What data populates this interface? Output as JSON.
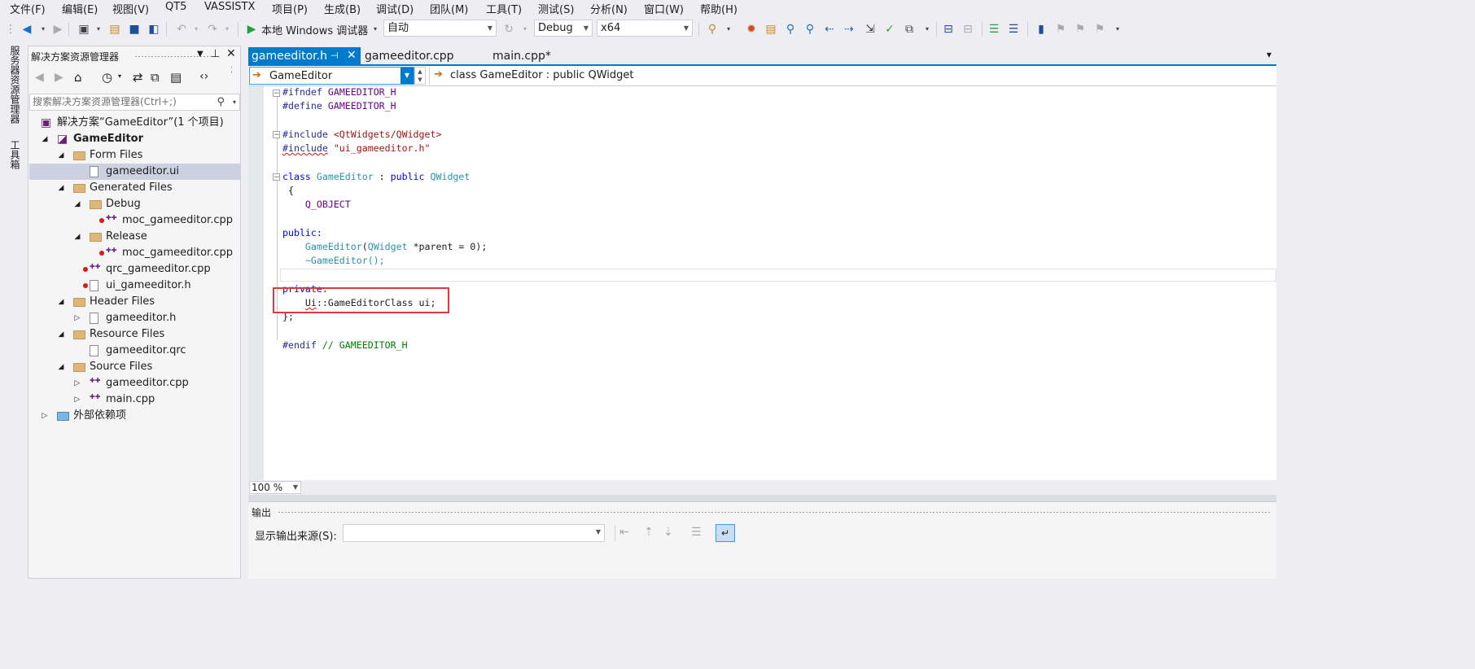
{
  "menu": [
    "文件(F)",
    "编辑(E)",
    "视图(V)",
    "QT5",
    "VASSISTX",
    "项目(P)",
    "生成(B)",
    "调试(D)",
    "团队(M)",
    "工具(T)",
    "测试(S)",
    "分析(N)",
    "窗口(W)",
    "帮助(H)"
  ],
  "toolbar": {
    "debugger_label": "本地 Windows 调试器",
    "config_auto": "自动",
    "configuration": "Debug",
    "platform": "x64"
  },
  "side_tabs": [
    "服务器资源管理器",
    "工具箱"
  ],
  "solution_explorer": {
    "title": "解决方案资源管理器",
    "search_placeholder": "搜索解决方案资源管理器(Ctrl+;)",
    "tree": [
      {
        "label": "解决方案“GameEditor”(1 个项目)",
        "indent": 0,
        "icon": "solution-icon",
        "expand": ""
      },
      {
        "label": "GameEditor",
        "indent": 1,
        "icon": "project-icon",
        "expand": "open",
        "bold": true
      },
      {
        "label": "Form Files",
        "indent": 2,
        "icon": "folder-icon",
        "expand": "open"
      },
      {
        "label": "gameeditor.ui",
        "indent": 3,
        "icon": "ui-file-icon",
        "expand": "",
        "selected": true
      },
      {
        "label": "Generated Files",
        "indent": 2,
        "icon": "folder-icon",
        "expand": "open"
      },
      {
        "label": "Debug",
        "indent": 3,
        "icon": "folder-icon",
        "expand": "open"
      },
      {
        "label": "moc_gameeditor.cpp",
        "indent": 4,
        "icon": "cpp-file-icon",
        "expand": "",
        "excluded": true
      },
      {
        "label": "Release",
        "indent": 3,
        "icon": "folder-icon",
        "expand": "open"
      },
      {
        "label": "moc_gameeditor.cpp",
        "indent": 4,
        "icon": "cpp-excluded-icon",
        "expand": "",
        "excluded": true
      },
      {
        "label": "qrc_gameeditor.cpp",
        "indent": 3,
        "icon": "cpp-file-icon",
        "expand": "",
        "excluded": true
      },
      {
        "label": "ui_gameeditor.h",
        "indent": 3,
        "icon": "header-file-icon",
        "expand": "",
        "excluded": true
      },
      {
        "label": "Header Files",
        "indent": 2,
        "icon": "folder-icon",
        "expand": "open"
      },
      {
        "label": "gameeditor.h",
        "indent": 3,
        "icon": "header-file-icon",
        "expand": "closed"
      },
      {
        "label": "Resource Files",
        "indent": 2,
        "icon": "folder-icon",
        "expand": "open"
      },
      {
        "label": "gameeditor.qrc",
        "indent": 3,
        "icon": "file-icon",
        "expand": ""
      },
      {
        "label": "Source Files",
        "indent": 2,
        "icon": "folder-icon",
        "expand": "open"
      },
      {
        "label": "gameeditor.cpp",
        "indent": 3,
        "icon": "cpp-file-icon",
        "expand": "closed"
      },
      {
        "label": "main.cpp",
        "indent": 3,
        "icon": "cpp-file-icon",
        "expand": "closed"
      },
      {
        "label": "外部依赖项",
        "indent": 1,
        "icon": "external-deps-icon",
        "expand": "closed"
      }
    ]
  },
  "editor": {
    "tabs": [
      {
        "label": "gameeditor.h",
        "active": true
      },
      {
        "label": "gameeditor.cpp",
        "active": false
      },
      {
        "label": "main.cpp*",
        "active": false
      }
    ],
    "scope_combo": "GameEditor",
    "member_combo": "class GameEditor : public QWidget",
    "zoom": "100 %"
  },
  "code": {
    "l1_kw": "#ifndef",
    "l1_rest": " GAMEEDITOR_H",
    "l2_kw": "#define",
    "l2_rest": " GAMEEDITOR_H",
    "l4_kw": "#include",
    "l4_str": " <QtWidgets/QWidget>",
    "l5_kw": "#include",
    "l5_str": " \"ui_gameeditor.h\"",
    "l7_kw": "class",
    "l7_name": " GameEditor",
    "l7_colon": " : ",
    "l7_pub": "public",
    "l7_base": " QWidget",
    "l8": " {",
    "l9": "    Q_OBJECT",
    "l11": "public:",
    "l12_indent": "    ",
    "l12_name": "GameEditor",
    "l12_open": "(",
    "l12_type": "QWidget",
    "l12_rest": " *parent = 0);",
    "l13": "    ~GameEditor();",
    "l15": "private:",
    "l16_indent": "    ",
    "l16_ns": "Ui",
    "l16_rest": "::GameEditorClass ui;",
    "l17": "};",
    "l19_kw": "#endif",
    "l19_cm": " // GAMEEDITOR_H"
  },
  "output": {
    "title": "输出",
    "source_label": "显示输出来源(S):"
  },
  "colors": {
    "accent": "#007acc",
    "highlight_box": "#e0393e",
    "background": "#eeeef2"
  }
}
